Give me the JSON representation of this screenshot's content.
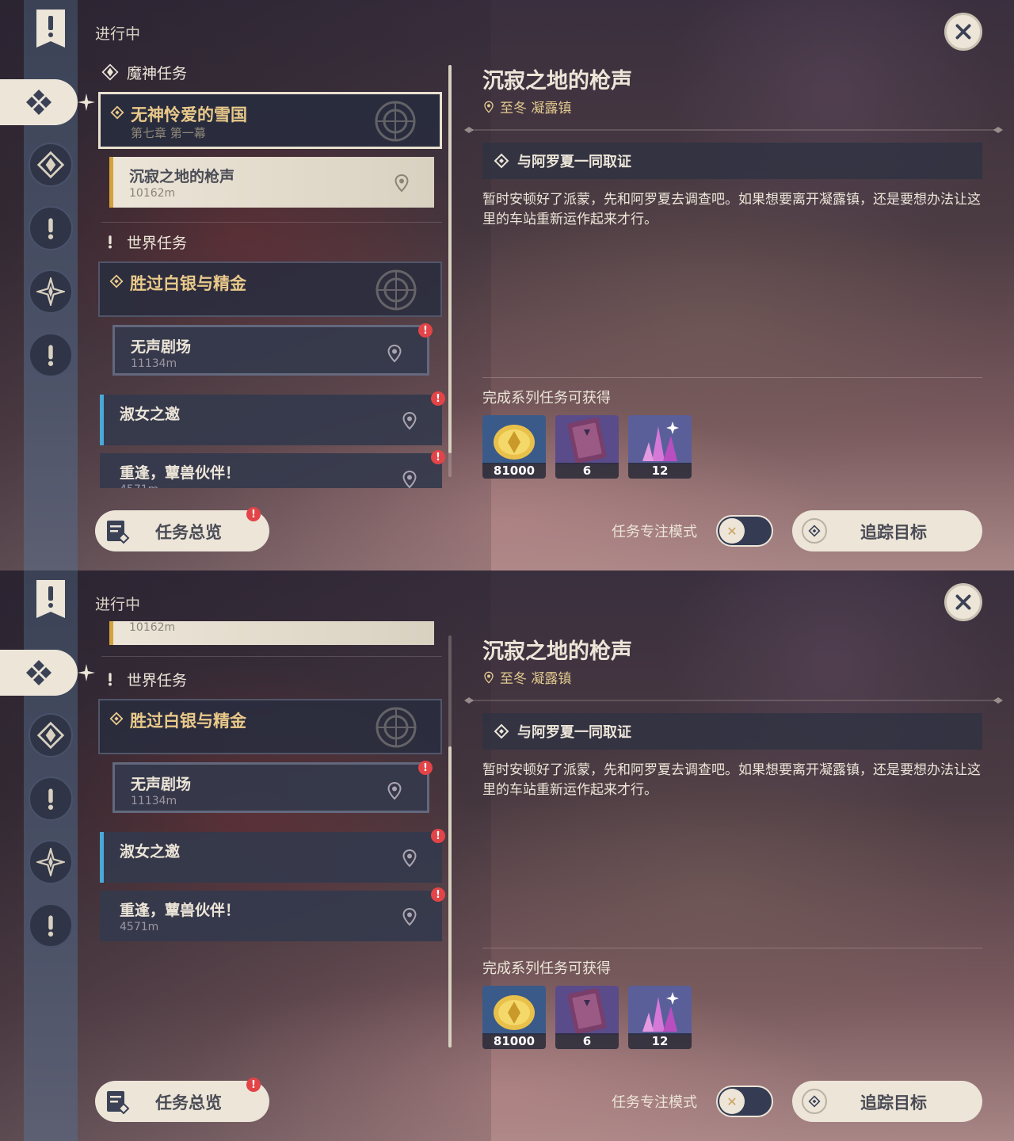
{
  "sidebar": {
    "section_label": "进行中"
  },
  "categories": {
    "archon": "魔神任务",
    "world": "世界任务"
  },
  "archon_quest": {
    "title": "无神怜爱的雪国",
    "subtitle": "第七章 第一幕"
  },
  "archon_step": {
    "title": "沉寂之地的枪声",
    "distance": "10162m"
  },
  "world_quest": {
    "title": "胜过白银与精金"
  },
  "world_steps": [
    {
      "title": "无声剧场",
      "distance": "11134m"
    },
    {
      "title": "淑女之邀",
      "distance": ""
    },
    {
      "title": "重逢，蕈兽伙伴！",
      "distance": "4571m"
    }
  ],
  "detail": {
    "title": "沉寂之地的枪声",
    "location": "至冬 凝露镇",
    "step": "与阿罗夏一同取证",
    "description": "暂时安顿好了派蒙，先和阿罗夏去调查吧。如果想要离开凝露镇，还是要想办法让这里的车站重新运作起来才行。",
    "rewards_label": "完成系列任务可获得",
    "rewards": [
      {
        "icon": "mora-coin-icon",
        "count": "81000"
      },
      {
        "icon": "heros-wit-book-icon",
        "count": "6"
      },
      {
        "icon": "primogem-crystal-icon",
        "count": "12"
      }
    ]
  },
  "footer": {
    "overview_label": "任务总览",
    "focus_mode_label": "任务专注模式",
    "focus_mode_on": false,
    "track_label": "追踪目标"
  },
  "scroll_state": {
    "top_panel": "top",
    "bottom_panel": "scrolled"
  }
}
